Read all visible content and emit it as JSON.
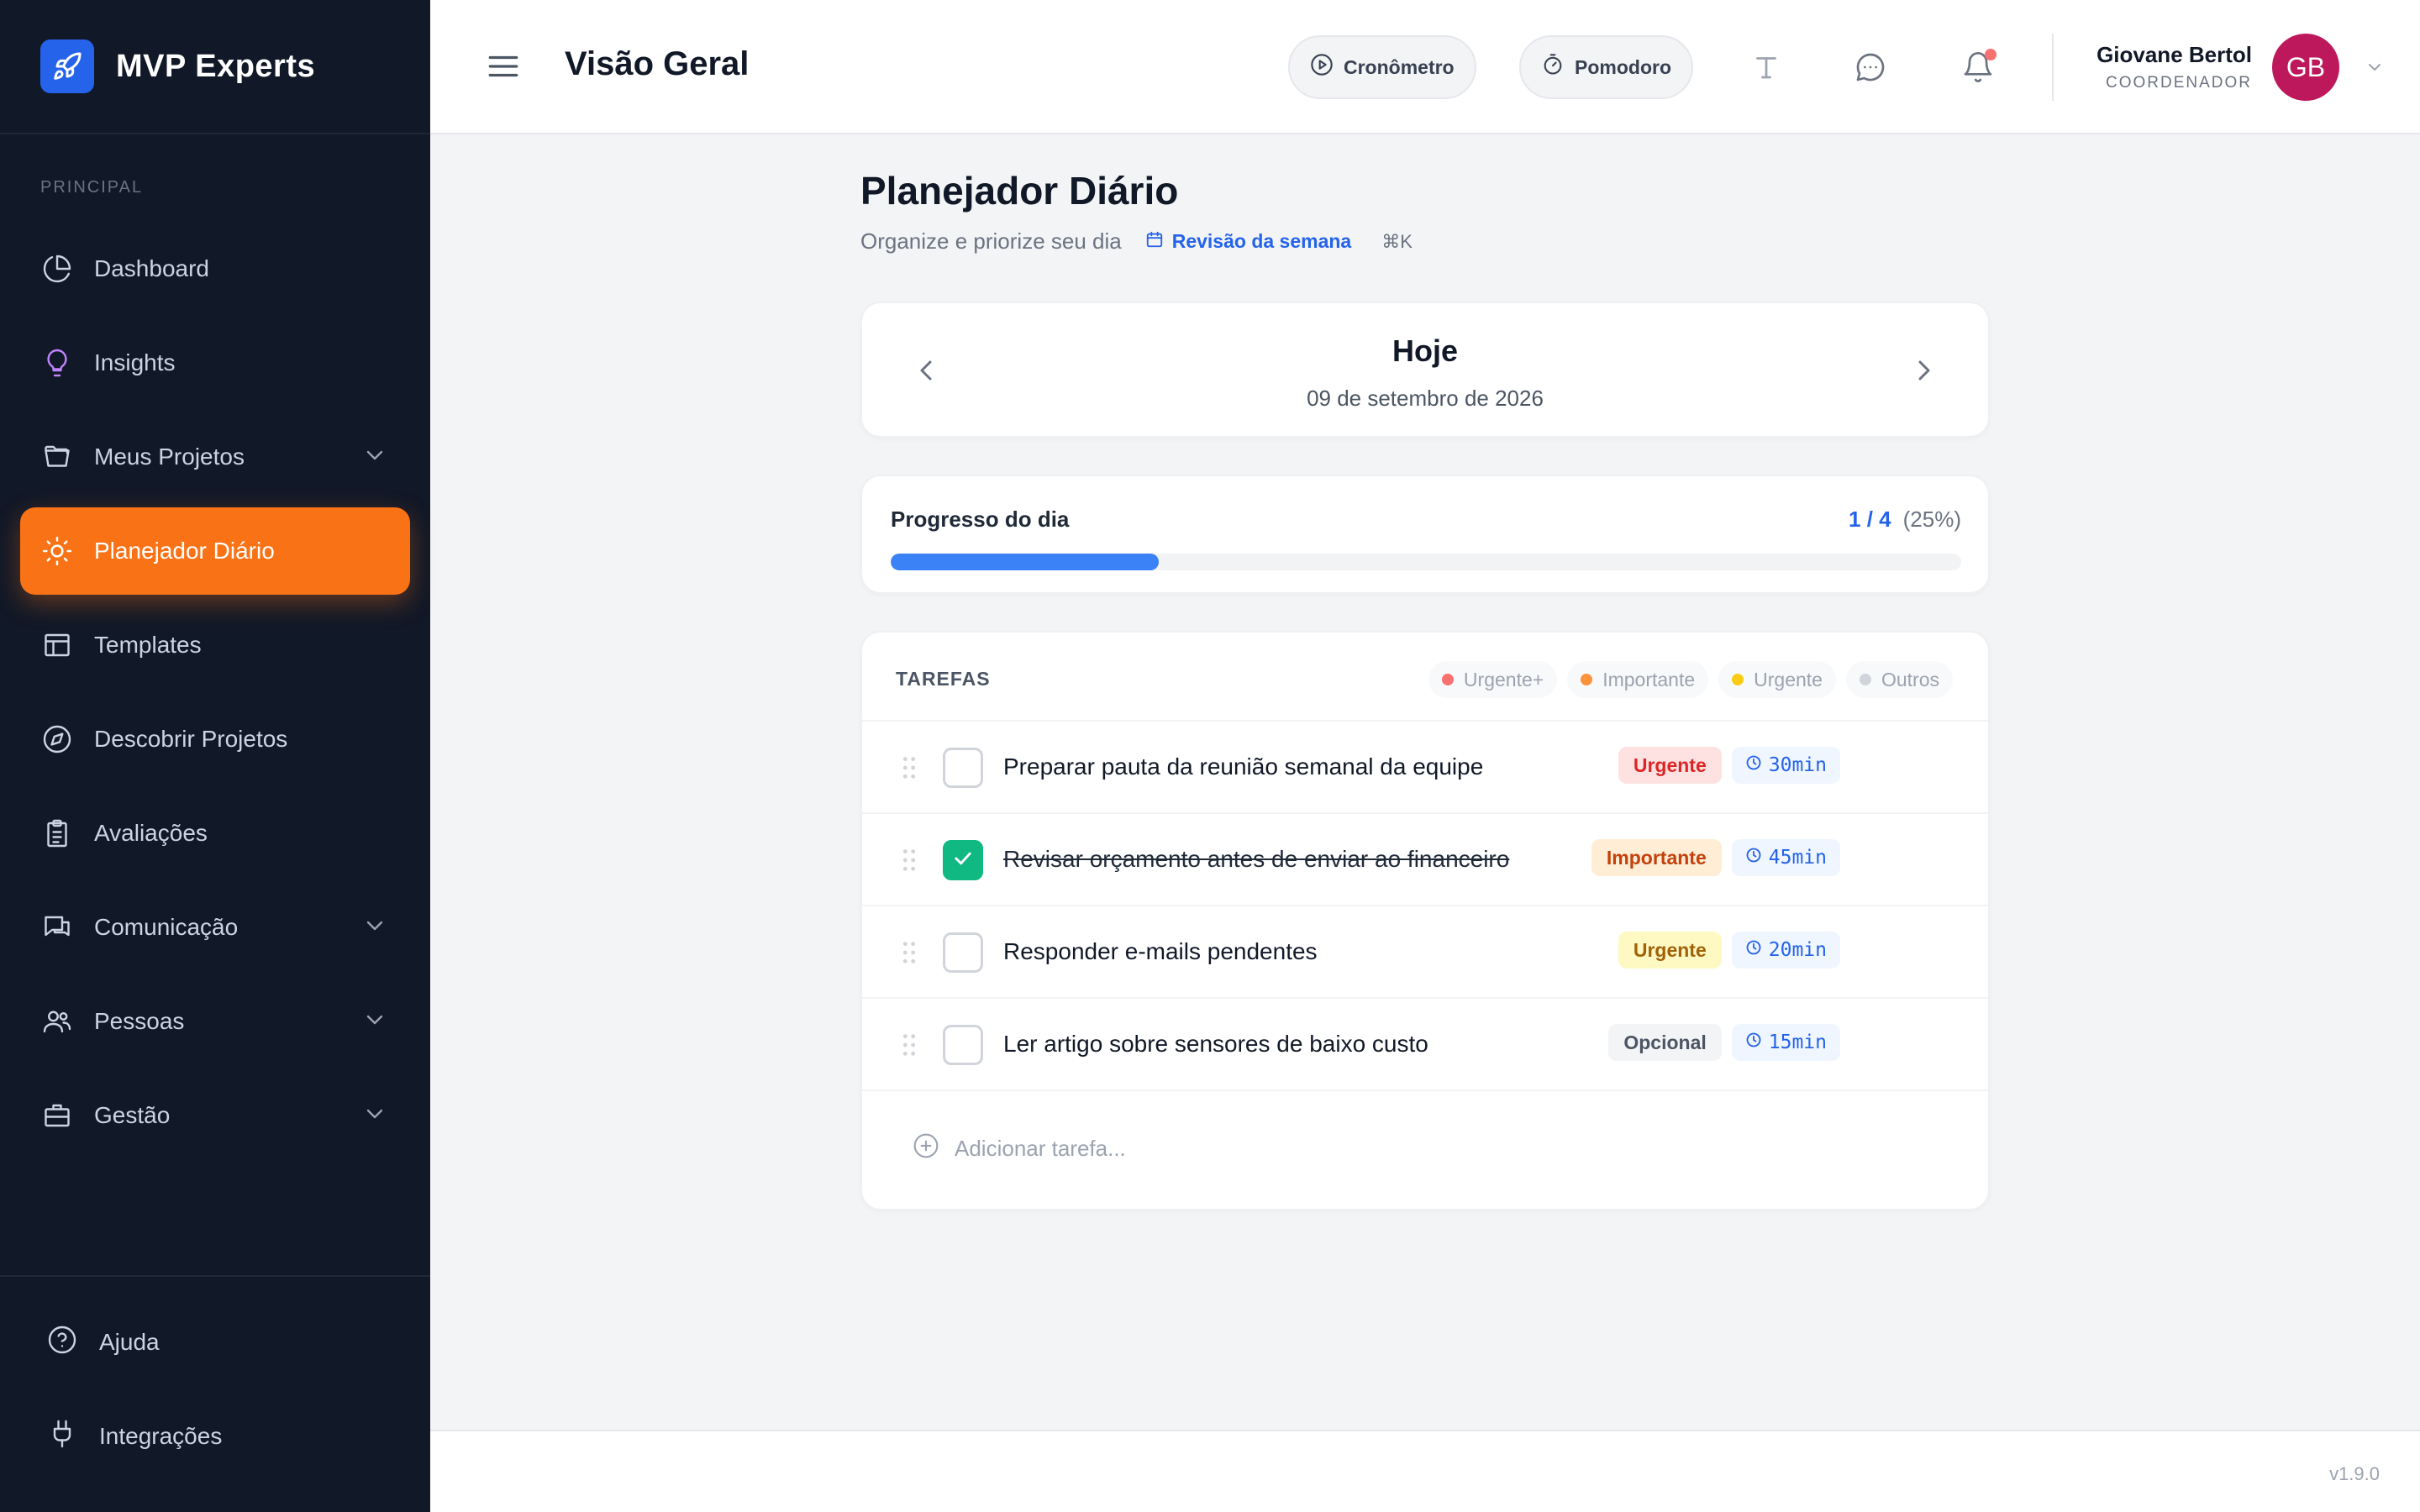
{
  "brand": {
    "name": "MVP Experts",
    "icon": "rocket-icon"
  },
  "sidebar": {
    "section_label": "PRINCIPAL",
    "items": [
      {
        "label": "Dashboard",
        "icon": "pie-chart-icon"
      },
      {
        "label": "Insights",
        "icon": "lightbulb-icon"
      },
      {
        "label": "Meus Projetos",
        "icon": "folder-icon",
        "expandable": true
      },
      {
        "label": "Planejador Diário",
        "icon": "sun-icon",
        "active": true
      },
      {
        "label": "Templates",
        "icon": "layout-icon"
      },
      {
        "label": "Descobrir Projetos",
        "icon": "compass-icon"
      },
      {
        "label": "Avaliações",
        "icon": "clipboard-icon"
      },
      {
        "label": "Comunicação",
        "icon": "chat-icon",
        "expandable": true
      },
      {
        "label": "Pessoas",
        "icon": "users-icon",
        "expandable": true
      },
      {
        "label": "Gestão",
        "icon": "briefcase-icon",
        "expandable": true
      }
    ],
    "bottom": [
      {
        "label": "Ajuda",
        "icon": "help-circle-icon"
      },
      {
        "label": "Integrações",
        "icon": "plug-icon"
      }
    ]
  },
  "header": {
    "title": "Visão Geral",
    "stopwatch_label": "Cronômetro",
    "pomodoro_label": "Pomodoro",
    "user": {
      "name": "Giovane Bertol",
      "role": "COORDENADOR",
      "initials": "GB",
      "avatar_color": "#be185d"
    }
  },
  "planner": {
    "title": "Planejador Diário",
    "subtitle": "Organize e priorize seu dia",
    "week_review": "Revisão da semana",
    "shortcut": "⌘K",
    "day_title": "Hoje",
    "day_date": "09 de setembro de 2026"
  },
  "progress": {
    "label": "Progresso do dia",
    "count": "1 / 4",
    "percent_label": "(25%)",
    "fraction": 0.25,
    "color": "#3b82f6"
  },
  "tasks": {
    "title": "TAREFAS",
    "legend": [
      {
        "label": "Urgente+",
        "color": "#f87171"
      },
      {
        "label": "Importante",
        "color": "#fb923c"
      },
      {
        "label": "Urgente",
        "color": "#facc15"
      },
      {
        "label": "Outros",
        "color": "#d1d5db"
      }
    ],
    "items": [
      {
        "text": "Preparar pauta da reunião semanal da equipe",
        "done": false,
        "badge": "Urgente",
        "badge_bg": "#fee2e2",
        "badge_color": "#dc2626",
        "time": "30min"
      },
      {
        "text": "Revisar orçamento antes de enviar ao financeiro",
        "done": true,
        "badge": "Importante",
        "badge_bg": "#ffedd5",
        "badge_color": "#c2410c",
        "time": "45min"
      },
      {
        "text": "Responder e-mails pendentes",
        "done": false,
        "badge": "Urgente",
        "badge_bg": "#fef9c3",
        "badge_color": "#a16207",
        "time": "20min"
      },
      {
        "text": "Ler artigo sobre sensores de baixo custo",
        "done": false,
        "badge": "Opcional",
        "badge_bg": "#f3f4f6",
        "badge_color": "#4b5563",
        "time": "15min"
      }
    ],
    "add_placeholder": "Adicionar tarefa..."
  },
  "footer": {
    "version": "v1.9.0"
  },
  "colors": {
    "accent": "#f97316",
    "brand": "#2563eb",
    "sidebar_bg": "#111827"
  }
}
